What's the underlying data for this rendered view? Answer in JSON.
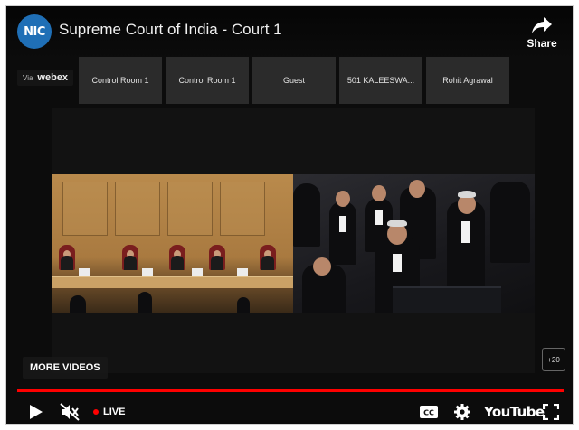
{
  "header": {
    "channel_logo_text": "NIC",
    "title": "Supreme Court of India - Court 1",
    "share_label": "Share"
  },
  "webex": {
    "via": "Via",
    "brand": "webex"
  },
  "participants": [
    {
      "label": "Control Room 1"
    },
    {
      "label": "Control Room 1"
    },
    {
      "label": "Guest"
    },
    {
      "label": "501 KALEESWA..."
    },
    {
      "label": "Rohit Agrawal"
    }
  ],
  "overlay": {
    "more_videos": "MORE VIDEOS",
    "extra_participants": "+20"
  },
  "controls": {
    "live_label": "LIVE",
    "youtube_label": "YouTube"
  },
  "colors": {
    "progress": "#ff0000",
    "live_dot": "#ff0000",
    "channel_logo": "#1f6fb6"
  },
  "icons": [
    "share-icon",
    "play-icon",
    "mute-icon",
    "captions-icon",
    "settings-icon",
    "fullscreen-icon"
  ]
}
